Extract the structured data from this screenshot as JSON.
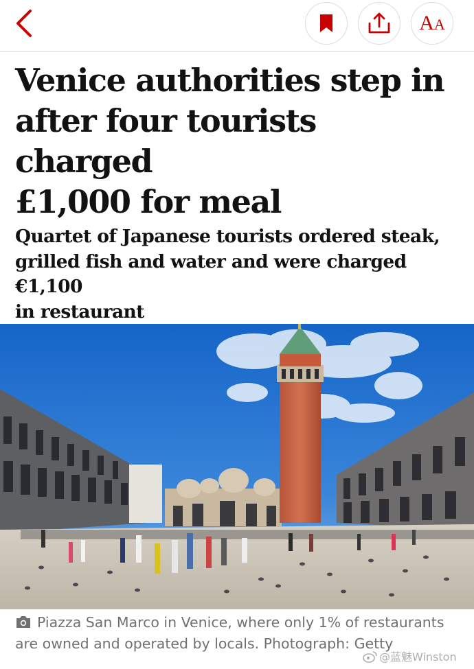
{
  "toolbar": {
    "aa_large": "A",
    "aa_small": "A",
    "accent_color": "#c70000",
    "icons": [
      "chevron-left-icon",
      "bookmark-icon",
      "share-icon",
      "text-size-icon"
    ]
  },
  "article": {
    "headline_lines": [
      "Venice authorities step in",
      "after four tourists charged",
      "£1,000 for meal"
    ],
    "standfirst_lines": [
      "Quartet of Japanese tourists ordered steak,",
      "grilled fish and water and were charged €1,100",
      "in restaurant"
    ],
    "caption_lines": [
      "Piazza San Marco in Venice, where only 1% of restaurants",
      "are owned and operated by locals. Photograph: Getty"
    ]
  },
  "watermark": {
    "text": "@蓝魅Winston"
  }
}
